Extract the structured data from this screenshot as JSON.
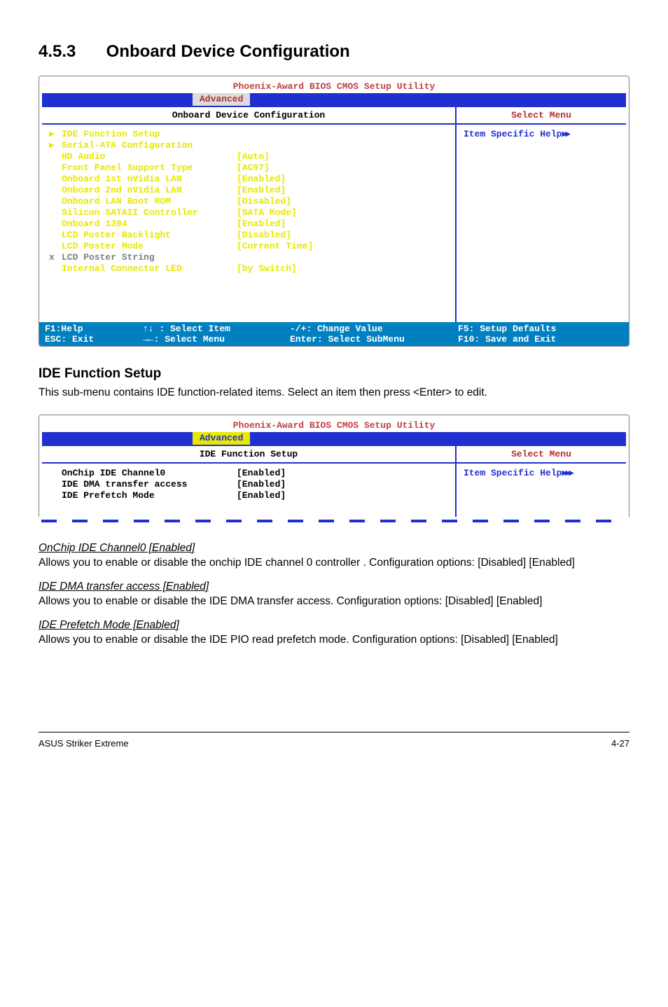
{
  "section": {
    "number": "4.5.3",
    "title": "Onboard Device Configuration"
  },
  "bios1": {
    "title": "Phoenix-Award BIOS CMOS Setup Utility",
    "active_tab": "Advanced",
    "left_header": "Onboard Device Configuration",
    "right_header": "Select Menu",
    "help_text": "Item Specific Help",
    "rows": [
      {
        "marker": "▶",
        "label": "IDE Function Setup",
        "val": "",
        "cls": "yellow"
      },
      {
        "marker": "▶",
        "label": "Serial-ATA Configuration",
        "val": "",
        "cls": "yellow"
      },
      {
        "marker": "",
        "label": "HD Audio",
        "val": "[Auto]",
        "cls": "yellow"
      },
      {
        "marker": "",
        "label": "Front Panel Support Type",
        "val": "[AC97]",
        "cls": "yellow"
      },
      {
        "marker": "",
        "label": "Onboard 1st nVidia LAN",
        "val": "[Enabled]",
        "cls": "yellow"
      },
      {
        "marker": "",
        "label": "Onboard 2nd nVidia LAN",
        "val": "[Enabled]",
        "cls": "yellow"
      },
      {
        "marker": "",
        "label": "Onboard LAN Boot ROM",
        "val": "[Disabled]",
        "cls": "yellow"
      },
      {
        "marker": "",
        "label": "Silicon SATAII Controller",
        "val": "[SATA Mode]",
        "cls": "yellow"
      },
      {
        "marker": "",
        "label": "Onboard 1394",
        "val": "[Enabled]",
        "cls": "yellow"
      },
      {
        "marker": "",
        "label": "LCD Poster Backlight",
        "val": "[Disabled]",
        "cls": "yellow"
      },
      {
        "marker": "",
        "label": "LCD Poster Mode",
        "val": "[Current Time]",
        "cls": "yellow"
      },
      {
        "marker": "x",
        "label": "LCD Poster String",
        "val": "",
        "cls": "gray"
      },
      {
        "marker": "",
        "label": "Internal Connector LED",
        "val": "[by Switch]",
        "cls": "yellow"
      }
    ],
    "footer": {
      "r1c1": "F1:Help",
      "r1c2": "↑↓ : Select Item",
      "r1c3": "-/+: Change Value",
      "r1c4": "F5: Setup Defaults",
      "r2c1": "ESC: Exit",
      "r2c2": "→←: Select Menu",
      "r2c3": "Enter: Select SubMenu",
      "r2c4": "F10: Save and Exit"
    }
  },
  "ide_section": {
    "heading": "IDE Function Setup",
    "desc": "This sub-menu contains IDE function-related items. Select an item then press <Enter> to edit."
  },
  "bios2": {
    "title": "Phoenix-Award BIOS CMOS Setup Utility",
    "active_tab": "Advanced",
    "left_header": "IDE Function Setup",
    "right_header": "Select Menu",
    "help_text": "Item Specific Help",
    "rows": [
      {
        "label": "OnChip IDE Channel0",
        "val": "[Enabled]"
      },
      {
        "label": "IDE DMA transfer access",
        "val": "[Enabled]"
      },
      {
        "label": "IDE Prefetch Mode",
        "val": "[Enabled]"
      }
    ]
  },
  "items": [
    {
      "title": "OnChip IDE Channel0 [Enabled]",
      "body": "Allows you to enable or disable the onchip IDE channel 0 controller . Configuration options: [Disabled] [Enabled]"
    },
    {
      "title": "IDE DMA transfer access [Enabled]",
      "body": "Allows you to enable or disable the IDE DMA transfer access. Configuration options: [Disabled] [Enabled]"
    },
    {
      "title": "IDE Prefetch Mode [Enabled]",
      "body": "Allows you to enable or disable the IDE PIO read prefetch mode. Configuration options: [Disabled] [Enabled]"
    }
  ],
  "footer": {
    "left": "ASUS Striker Extreme",
    "right": "4-27"
  }
}
